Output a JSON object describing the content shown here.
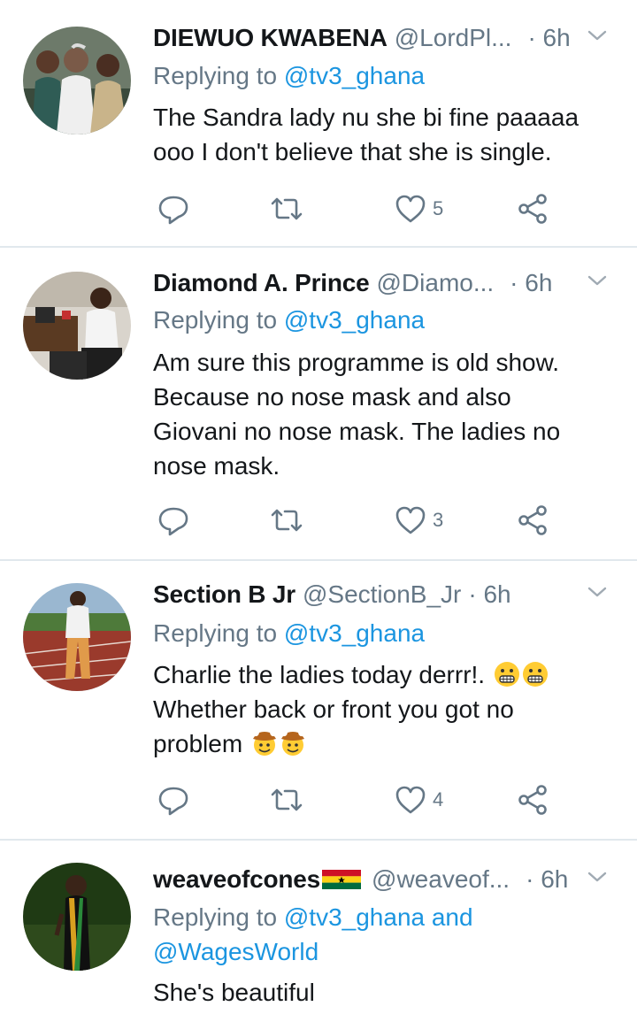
{
  "tweets": [
    {
      "name": "DIEWUO KWABENA",
      "handle": "@LordPl...",
      "time": "· 6h",
      "reply_label": "Replying to",
      "reply_mentions": "@tv3_ghana",
      "body_lines": [
        "The Sandra lady nu she bi fine paaaaa",
        "ooo I don't believe that she is single."
      ],
      "likes": "5",
      "avatar_icon": "group-photo-avatar"
    },
    {
      "name": "Diamond A. Prince",
      "handle": "@Diamo...",
      "time": "· 6h",
      "reply_label": "Replying to",
      "reply_mentions": "@tv3_ghana",
      "body_lines": [
        "Am sure this programme is old show.",
        "Because no nose mask and also",
        "Giovani no nose mask. The ladies no",
        "nose mask."
      ],
      "likes": "3",
      "avatar_icon": "office-photo-avatar"
    },
    {
      "name": "Section B Jr",
      "handle": "@SectionB_Jr",
      "time": "· 6h",
      "reply_label": "Replying to",
      "reply_mentions": "@tv3_ghana",
      "body_lines": [
        "Charlie the ladies today derrr!.",
        "Whether back or front you got no",
        "problem"
      ],
      "likes": "4",
      "avatar_icon": "track-photo-avatar"
    },
    {
      "name": "weaveofcones",
      "handle": "@weaveof...",
      "time": "· 6h",
      "reply_label": "Replying to",
      "reply_mentions": "@tv3_ghana and",
      "reply_mentions_2": "@WagesWorld",
      "body_lines": [
        "She's beautiful"
      ],
      "likes": "",
      "avatar_icon": "graduation-photo-avatar"
    }
  ],
  "colors": {
    "text": "#14171a",
    "secondary": "#657786",
    "mention": "#1b95e0",
    "divider": "#e1e8ed"
  },
  "icons": [
    "reply-icon",
    "retweet-icon",
    "like-icon",
    "share-icon",
    "caret-down-icon",
    "grimacing-emoji",
    "cowboy-emoji",
    "ghana-flag-icon"
  ]
}
